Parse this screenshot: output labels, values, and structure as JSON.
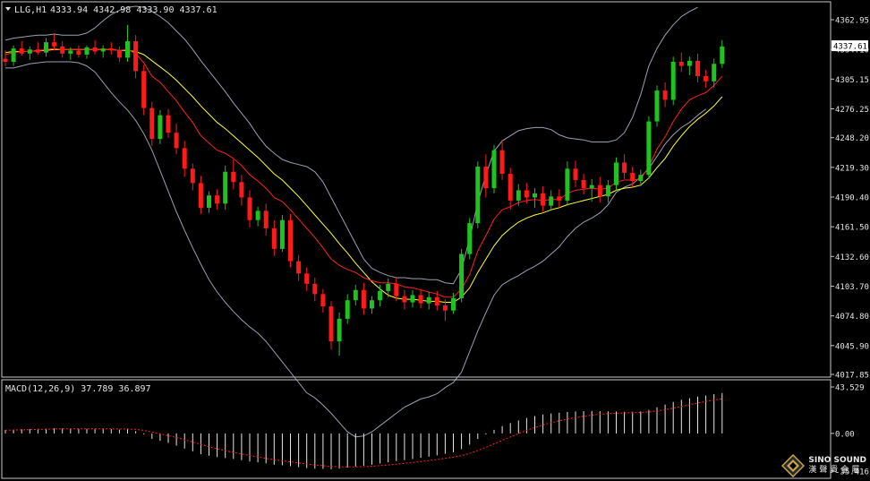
{
  "header": {
    "symbol": "LLG,H1",
    "ohlc": "4333.94 4342.98 4333.90 4337.61"
  },
  "macd_label": "MACD(12,26,9) 37.789 36.897",
  "last_price_label": "4337.61",
  "branding": {
    "line1": "SINO SOUND",
    "line2": "漢聲貴金屬"
  },
  "colors": {
    "background": "#000000",
    "frame": "#c8c8c8",
    "bull": "#1fc31f",
    "bear": "#ff1a1a",
    "ma_fast": "#ff2020",
    "ma_slow": "#ffff33",
    "bollinger": "#9aa0b4",
    "macd_hist": "#e6e6e6",
    "macd_signal": "#ff2020",
    "text": "#e6e6e6"
  },
  "chart_data": [
    {
      "type": "candlestick",
      "title": "LLG,H1",
      "ylim": [
        4017.85,
        4362.95
      ],
      "y_ticks": [
        "4362.95",
        "4334.10",
        "4305.15",
        "4276.25",
        "4248.20",
        "4219.30",
        "4190.40",
        "4161.50",
        "4132.60",
        "4103.70",
        "4074.80",
        "4045.90",
        "4017.85"
      ],
      "last_price": 4337.61,
      "ohlc": [
        [
          4325,
          4333,
          4318,
          4322
        ],
        [
          4322,
          4338,
          4318,
          4335
        ],
        [
          4335,
          4342,
          4328,
          4330
        ],
        [
          4330,
          4337,
          4324,
          4334
        ],
        [
          4334,
          4341,
          4329,
          4331
        ],
        [
          4331,
          4345,
          4327,
          4341
        ],
        [
          4341,
          4349,
          4333,
          4337
        ],
        [
          4337,
          4342,
          4326,
          4330
        ],
        [
          4330,
          4336,
          4324,
          4333
        ],
        [
          4333,
          4338,
          4326,
          4329
        ],
        [
          4329,
          4338,
          4325,
          4336
        ],
        [
          4336,
          4343,
          4329,
          4332
        ],
        [
          4332,
          4338,
          4326,
          4335
        ],
        [
          4335,
          4341,
          4329,
          4333
        ],
        [
          4333,
          4337,
          4322,
          4326
        ],
        [
          4326,
          4358,
          4322,
          4342
        ],
        [
          4342,
          4348,
          4306,
          4313
        ],
        [
          4313,
          4319,
          4270,
          4277
        ],
        [
          4277,
          4283,
          4240,
          4247
        ],
        [
          4247,
          4275,
          4242,
          4270
        ],
        [
          4270,
          4276,
          4248,
          4253
        ],
        [
          4253,
          4262,
          4232,
          4238
        ],
        [
          4238,
          4245,
          4210,
          4218
        ],
        [
          4218,
          4223,
          4197,
          4204
        ],
        [
          4204,
          4211,
          4174,
          4180
        ],
        [
          4180,
          4196,
          4175,
          4192
        ],
        [
          4192,
          4198,
          4178,
          4184
        ],
        [
          4184,
          4221,
          4178,
          4215
        ],
        [
          4215,
          4227,
          4198,
          4205
        ],
        [
          4205,
          4212,
          4182,
          4190
        ],
        [
          4190,
          4197,
          4161,
          4168
        ],
        [
          4168,
          4181,
          4162,
          4177
        ],
        [
          4177,
          4184,
          4153,
          4160
        ],
        [
          4160,
          4168,
          4133,
          4140
        ],
        [
          4140,
          4173,
          4137,
          4168
        ],
        [
          4168,
          4174,
          4122,
          4128
        ],
        [
          4128,
          4134,
          4109,
          4116
        ],
        [
          4116,
          4122,
          4099,
          4106
        ],
        [
          4106,
          4112,
          4089,
          4096
        ],
        [
          4096,
          4101,
          4078,
          4084
        ],
        [
          4084,
          4089,
          4042,
          4050
        ],
        [
          4050,
          4078,
          4036,
          4072
        ],
        [
          4072,
          4096,
          4067,
          4090
        ],
        [
          4090,
          4105,
          4085,
          4100
        ],
        [
          4100,
          4107,
          4076,
          4082
        ],
        [
          4082,
          4094,
          4077,
          4090
        ],
        [
          4090,
          4105,
          4084,
          4099
        ],
        [
          4099,
          4111,
          4093,
          4106
        ],
        [
          4106,
          4112,
          4089,
          4094
        ],
        [
          4094,
          4100,
          4081,
          4088
        ],
        [
          4088,
          4100,
          4083,
          4095
        ],
        [
          4095,
          4101,
          4082,
          4087
        ],
        [
          4087,
          4098,
          4081,
          4093
        ],
        [
          4093,
          4099,
          4080,
          4085
        ],
        [
          4085,
          4091,
          4070,
          4080
        ],
        [
          4080,
          4097,
          4077,
          4092
        ],
        [
          4092,
          4140,
          4088,
          4135
        ],
        [
          4135,
          4170,
          4130,
          4165
        ],
        [
          4165,
          4225,
          4160,
          4220
        ],
        [
          4220,
          4232,
          4190,
          4199
        ],
        [
          4199,
          4241,
          4194,
          4236
        ],
        [
          4236,
          4246,
          4207,
          4213
        ],
        [
          4213,
          4219,
          4178,
          4187
        ],
        [
          4187,
          4203,
          4182,
          4197
        ],
        [
          4197,
          4204,
          4184,
          4190
        ],
        [
          4190,
          4199,
          4180,
          4194
        ],
        [
          4194,
          4201,
          4176,
          4182
        ],
        [
          4182,
          4197,
          4177,
          4191
        ],
        [
          4191,
          4198,
          4180,
          4187
        ],
        [
          4187,
          4225,
          4182,
          4218
        ],
        [
          4218,
          4226,
          4200,
          4207
        ],
        [
          4207,
          4213,
          4193,
          4199
        ],
        [
          4199,
          4208,
          4186,
          4202
        ],
        [
          4202,
          4210,
          4185,
          4191
        ],
        [
          4191,
          4207,
          4185,
          4202
        ],
        [
          4202,
          4229,
          4197,
          4224
        ],
        [
          4224,
          4232,
          4208,
          4214
        ],
        [
          4214,
          4220,
          4200,
          4206
        ],
        [
          4206,
          4217,
          4201,
          4212
        ],
        [
          4212,
          4269,
          4208,
          4264
        ],
        [
          4264,
          4299,
          4259,
          4294
        ],
        [
          4294,
          4302,
          4278,
          4285
        ],
        [
          4285,
          4327,
          4280,
          4322
        ],
        [
          4322,
          4331,
          4312,
          4318
        ],
        [
          4318,
          4327,
          4309,
          4323
        ],
        [
          4323,
          4330,
          4302,
          4308
        ],
        [
          4308,
          4314,
          4297,
          4303
        ],
        [
          4303,
          4325,
          4297,
          4320
        ],
        [
          4320,
          4343,
          4316,
          4337
        ]
      ],
      "ma_fast": [
        4329,
        4331,
        4332,
        4332,
        4333,
        4334,
        4335,
        4334,
        4334,
        4334,
        4334,
        4334,
        4334,
        4334,
        4333,
        4334,
        4330,
        4321,
        4308,
        4302,
        4293,
        4284,
        4273,
        4263,
        4250,
        4243,
        4236,
        4233,
        4228,
        4221,
        4212,
        4206,
        4199,
        4190,
        4186,
        4178,
        4169,
        4160,
        4151,
        4141,
        4130,
        4124,
        4120,
        4117,
        4112,
        4109,
        4107,
        4107,
        4106,
        4103,
        4102,
        4100,
        4098,
        4096,
        4093,
        4093,
        4101,
        4115,
        4138,
        4153,
        4169,
        4178,
        4181,
        4185,
        4187,
        4188,
        4187,
        4188,
        4188,
        4194,
        4197,
        4198,
        4199,
        4198,
        4199,
        4205,
        4207,
        4207,
        4208,
        4220,
        4237,
        4249,
        4264,
        4276,
        4285,
        4289,
        4292,
        4299,
        4308
      ],
      "ma_slow": [
        4331,
        4332,
        4332,
        4332,
        4333,
        4333,
        4334,
        4334,
        4334,
        4334,
        4334,
        4334,
        4334,
        4334,
        4333,
        4333,
        4332,
        4329,
        4323,
        4317,
        4311,
        4304,
        4296,
        4288,
        4279,
        4271,
        4263,
        4257,
        4250,
        4243,
        4236,
        4229,
        4221,
        4213,
        4207,
        4199,
        4191,
        4182,
        4173,
        4164,
        4155,
        4145,
        4136,
        4126,
        4117,
        4108,
        4101,
        4095,
        4092,
        4091,
        4091,
        4090,
        4089,
        4089,
        4088,
        4088,
        4093,
        4102,
        4117,
        4130,
        4143,
        4153,
        4160,
        4166,
        4170,
        4173,
        4175,
        4178,
        4180,
        4183,
        4185,
        4187,
        4189,
        4191,
        4193,
        4197,
        4199,
        4200,
        4202,
        4209,
        4219,
        4228,
        4240,
        4250,
        4259,
        4266,
        4272,
        4279,
        4288
      ],
      "bb_upper": [
        4343,
        4345,
        4346,
        4347,
        4348,
        4348,
        4349,
        4348,
        4348,
        4348,
        4350,
        4355,
        4362,
        4368,
        4372,
        4375,
        4376,
        4375,
        4371,
        4366,
        4360,
        4352,
        4344,
        4334,
        4323,
        4313,
        4303,
        4293,
        4282,
        4272,
        4262,
        4250,
        4240,
        4233,
        4227,
        4224,
        4222,
        4220,
        4215,
        4205,
        4190,
        4175,
        4160,
        4145,
        4130,
        4121,
        4117,
        4114,
        4112,
        4112,
        4111,
        4111,
        4110,
        4110,
        4107,
        4106,
        4120,
        4150,
        4185,
        4212,
        4235,
        4245,
        4250,
        4255,
        4257,
        4258,
        4258,
        4256,
        4251,
        4248,
        4247,
        4246,
        4244,
        4244,
        4244,
        4246,
        4253,
        4268,
        4290,
        4318,
        4335,
        4348,
        4358,
        4366,
        4371,
        4375
      ],
      "bb_lower": [
        4316,
        4316,
        4318,
        4320,
        4321,
        4322,
        4322,
        4322,
        4322,
        4321,
        4318,
        4312,
        4302,
        4292,
        4283,
        4275,
        4265,
        4252,
        4236,
        4216,
        4196,
        4176,
        4158,
        4141,
        4125,
        4110,
        4098,
        4088,
        4079,
        4071,
        4064,
        4058,
        4050,
        4040,
        4030,
        4020,
        4010,
        4000,
        3995,
        3988,
        3980,
        3971,
        3962,
        3957,
        3958,
        3962,
        3968,
        3974,
        3980,
        3986,
        3990,
        3994,
        3996,
        3999,
        4005,
        4010,
        4020,
        4040,
        4060,
        4078,
        4095,
        4105,
        4110,
        4114,
        4119,
        4123,
        4128,
        4135,
        4142,
        4152,
        4160,
        4166,
        4170,
        4175,
        4183,
        4195,
        4200,
        4203,
        4210,
        4218,
        4230,
        4242,
        4251,
        4258,
        4263,
        4270,
        4276
      ]
    },
    {
      "type": "bar",
      "title": "MACD(12,26,9) 37.789 36.897",
      "series": [
        {
          "name": "MACD",
          "values": [
            3.2,
            3.5,
            3.9,
            4.1,
            4.3,
            4.5,
            4.7,
            4.5,
            4.4,
            4.3,
            4.3,
            4.2,
            4.1,
            4.0,
            3.6,
            4.3,
            2.1,
            -1.0,
            -5.1,
            -7.0,
            -9.0,
            -11.5,
            -14.2,
            -16.8,
            -19.5,
            -21.0,
            -22.2,
            -23.1,
            -24.0,
            -25.1,
            -26.3,
            -27.2,
            -28.1,
            -29.4,
            -29.9,
            -30.8,
            -31.7,
            -32.5,
            -33.0,
            -33.3,
            -33.6,
            -33.0,
            -32.0,
            -31.1,
            -30.3,
            -29.3,
            -28.2,
            -27.2,
            -26.0,
            -25.0,
            -24.1,
            -22.9,
            -21.8,
            -20.6,
            -19.1,
            -17.7,
            -14.8,
            -10.6,
            -5.2,
            -1.0,
            3.3,
            6.8,
            9.6,
            12.1,
            14.5,
            16.2,
            17.7,
            18.7,
            19.4,
            20.1,
            20.5,
            20.8,
            21.0,
            20.9,
            20.7,
            20.5,
            20.3,
            20.3,
            20.5,
            22.0,
            24.5,
            27.0,
            29.5,
            31.5,
            33.0,
            34.5,
            35.5,
            36.8,
            37.8
          ]
        },
        {
          "name": "Signal",
          "values": [
            3.0,
            3.1,
            3.3,
            3.5,
            3.7,
            3.9,
            4.1,
            4.2,
            4.3,
            4.3,
            4.3,
            4.3,
            4.3,
            4.2,
            4.1,
            4.1,
            3.7,
            2.8,
            1.2,
            -0.4,
            -2.1,
            -3.9,
            -5.9,
            -8.0,
            -10.3,
            -12.5,
            -14.5,
            -16.2,
            -17.8,
            -19.3,
            -20.7,
            -22.1,
            -23.4,
            -24.7,
            -25.7,
            -26.7,
            -27.7,
            -28.7,
            -29.6,
            -30.3,
            -31.0,
            -31.4,
            -31.5,
            -31.4,
            -31.2,
            -30.8,
            -30.2,
            -29.6,
            -28.9,
            -28.1,
            -27.3,
            -26.4,
            -25.5,
            -24.5,
            -23.4,
            -22.3,
            -20.8,
            -18.8,
            -16.1,
            -13.1,
            -9.8,
            -6.5,
            -3.3,
            -0.2,
            2.8,
            5.5,
            7.9,
            10.0,
            11.8,
            13.5,
            14.9,
            16.1,
            17.1,
            17.9,
            18.5,
            18.9,
            19.2,
            19.4,
            19.6,
            20.1,
            21.0,
            22.2,
            23.7,
            25.3,
            26.8,
            28.4,
            29.8,
            31.2,
            32.5
          ]
        }
      ],
      "y_ticks": [
        "43.529",
        "0.00",
        "-35.416"
      ],
      "ylim": [
        -35.416,
        43.529
      ]
    }
  ]
}
